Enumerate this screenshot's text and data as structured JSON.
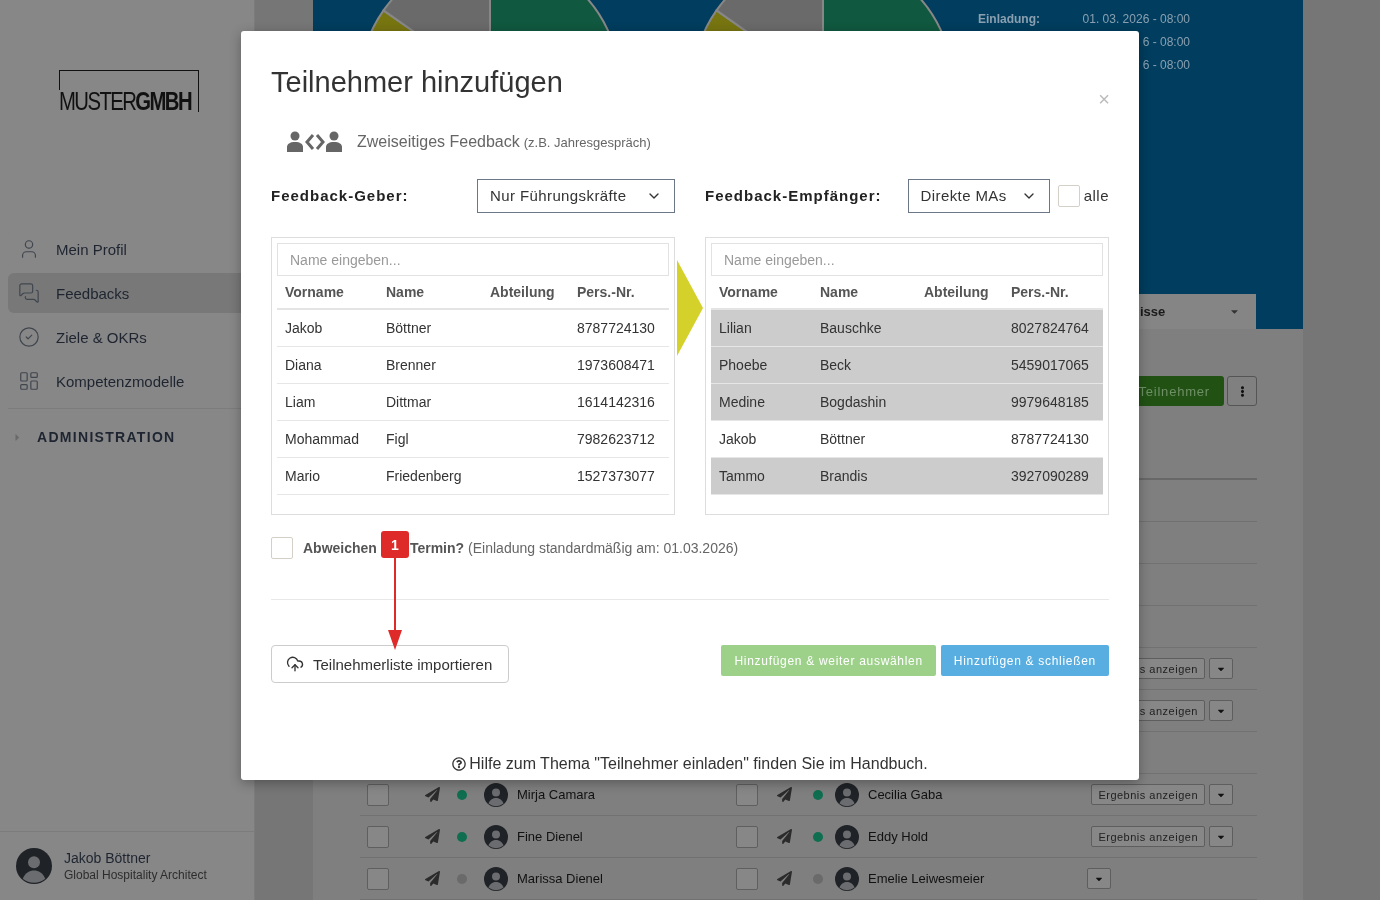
{
  "sidebar": {
    "logo": "MUSTER**GMBH**",
    "nav": [
      {
        "label": "Mein Profil",
        "selected": false
      },
      {
        "label": "Feedbacks",
        "selected": true
      },
      {
        "label": "Ziele & OKRs",
        "selected": false
      },
      {
        "label": "Kompetenzmodelle",
        "selected": false
      }
    ],
    "section": {
      "label": "ADMINISTRATION",
      "expanded": false
    },
    "user": {
      "name": "Jakob Böttner",
      "role": "Global Hospitality Architect"
    }
  },
  "overview": {
    "details": [
      {
        "label": "Einladung:",
        "value": "01. 03. 2026 - 08:00"
      },
      {
        "value": "6 - 08:00"
      },
      {
        "value": "6 - 08:00"
      }
    ],
    "view_select": "isse",
    "add_button": "Teilnehmer",
    "rows": [
      {
        "kind": "blank"
      },
      {
        "kind": "blank"
      },
      {
        "kind": "blank"
      },
      {
        "kind": "blank"
      },
      {
        "kind": "partial",
        "result": "s anzeigen"
      },
      {
        "kind": "partial",
        "result": "s anzeigen"
      },
      {
        "kind": "blank"
      },
      {
        "kind": "pair",
        "left": {
          "name": "Mirja Camara",
          "checked": false,
          "color": "#0f6e4f"
        },
        "right": {
          "name": "Cecilia Gaba",
          "checked": false,
          "color": "#0f6e4f"
        },
        "result": "Ergebnis anzeigen"
      },
      {
        "kind": "pair",
        "left": {
          "name": "Fine Dienel",
          "checked": false,
          "color": "#0f6e4f"
        },
        "right": {
          "name": "Eddy Hold",
          "checked": false,
          "color": "#0f6e4f"
        },
        "result": "Ergebnis anzeigen"
      },
      {
        "kind": "pair",
        "left": {
          "name": "Marissa Dienel",
          "checked": false,
          "color": "#6a6a6a"
        },
        "right": {
          "name": "Emelie Leiwesmeier",
          "checked": false,
          "color": "#6a6a6a"
        }
      }
    ]
  },
  "dialog": {
    "title": "Teilnehmer hinzufügen",
    "close": "×",
    "type": {
      "label": "Zweiseitiges Feedback",
      "hint": "(z.B. Jahresgespräch)"
    },
    "giver": {
      "label": "Feedback-Geber:",
      "select": "Nur Führungskräfte",
      "search_placeholder": "Name eingeben...",
      "columns": [
        "Vorname",
        "Name",
        "Abteilung",
        "Pers.-Nr."
      ],
      "rows": [
        {
          "first": "Jakob",
          "last": "Böttner",
          "number": "8787724130",
          "selected": false
        },
        {
          "first": "Diana",
          "last": "Brenner",
          "number": "1973608471",
          "selected": false
        },
        {
          "first": "Liam",
          "last": "Dittmar",
          "number": "1614142316",
          "selected": false
        },
        {
          "first": "Mohammad",
          "last": "Figl",
          "number": "7982623712",
          "selected": false
        },
        {
          "first": "Mario",
          "last": "Friedenberg",
          "number": "1527373077",
          "selected": false
        }
      ]
    },
    "receiver": {
      "label": "Feedback-Empfänger:",
      "select": "Direkte MAs",
      "all": {
        "label": "alle",
        "checked": false
      },
      "search_placeholder": "Name eingeben...",
      "columns": [
        "Vorname",
        "Name",
        "Abteilung",
        "Pers.-Nr."
      ],
      "rows": [
        {
          "first": "Lilian",
          "last": "Bauschke",
          "number": "8027824764",
          "selected": true
        },
        {
          "first": "Phoebe",
          "last": "Beck",
          "number": "5459017065",
          "selected": true
        },
        {
          "first": "Medine",
          "last": "Bogdashin",
          "number": "9979648185",
          "selected": true
        },
        {
          "first": "Jakob",
          "last": "Böttner",
          "number": "8787724130",
          "selected": false
        },
        {
          "first": "Tammo",
          "last": "Brandis",
          "number": "3927090289",
          "selected": true
        }
      ]
    },
    "date_option": {
      "checked": false,
      "label_start": "Abweichen",
      "label_end": "Termin?",
      "hint": "(Einladung standardmäßig am: 01.03.2026)"
    },
    "annotation": {
      "number": "1"
    },
    "import_button": "Teilnehmerliste importieren",
    "actions": [
      {
        "label": "Hinzufügen & weiter auswählen",
        "kind": "secondary"
      },
      {
        "label": "Hinzufügen & schließen",
        "kind": "primary"
      }
    ],
    "help": "Hilfe zum Thema \"Teilnehmer einladen\" finden Sie im Handbuch."
  }
}
